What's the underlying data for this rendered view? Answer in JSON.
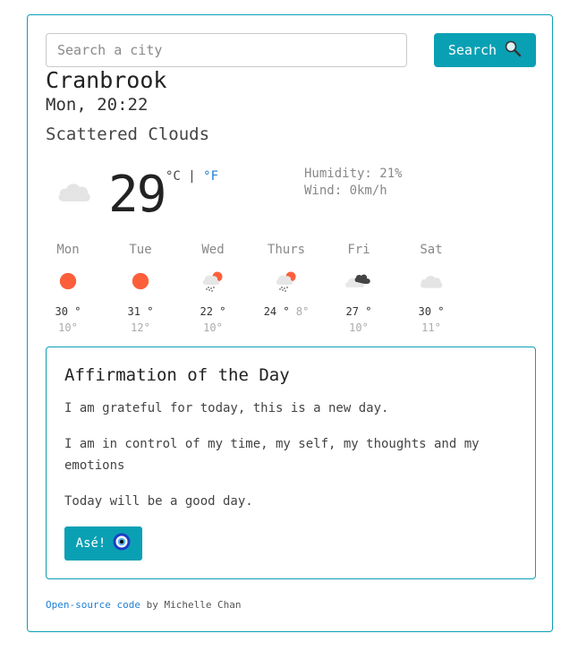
{
  "search": {
    "placeholder": "Search a city",
    "button_label": "Search"
  },
  "current": {
    "city": "Cranbrook",
    "datetime": "Mon, 20:22",
    "description": "Scattered Clouds",
    "temperature": "29",
    "unit_c": "°C",
    "separator": "|",
    "unit_f": "°F",
    "humidity": "Humidity: 21%",
    "wind": "Wind: 0km/h",
    "icon": "cloud-icon"
  },
  "forecast": [
    {
      "day": "Mon",
      "high": "30 °",
      "low": "10°",
      "icon": "sun-icon"
    },
    {
      "day": "Tue",
      "high": "31 °",
      "low": "12°",
      "icon": "sun-icon"
    },
    {
      "day": "Wed",
      "high": "22 °",
      "low": "10°",
      "icon": "rain-sun-icon"
    },
    {
      "day": "Thurs",
      "high": "24 °",
      "low": "8°",
      "icon": "rain-sun-icon"
    },
    {
      "day": "Fri",
      "high": "27 °",
      "low": "10°",
      "icon": "dark-clouds-icon"
    },
    {
      "day": "Sat",
      "high": "30 °",
      "low": "11°",
      "icon": "cloud-icon"
    }
  ],
  "affirmation": {
    "title": "Affirmation of the Day",
    "lines": [
      "I am grateful for today, this is a new day.",
      "I am in control of my time, my self, my thoughts and my emotions",
      "Today will be a good day."
    ],
    "button_label": "Asé!"
  },
  "footer": {
    "link_text": "Open-source code",
    "text": " by Michelle Chan"
  },
  "colors": {
    "accent": "#0aa0b4",
    "link": "#1e7fd6",
    "sun": "#fd5f3b"
  }
}
